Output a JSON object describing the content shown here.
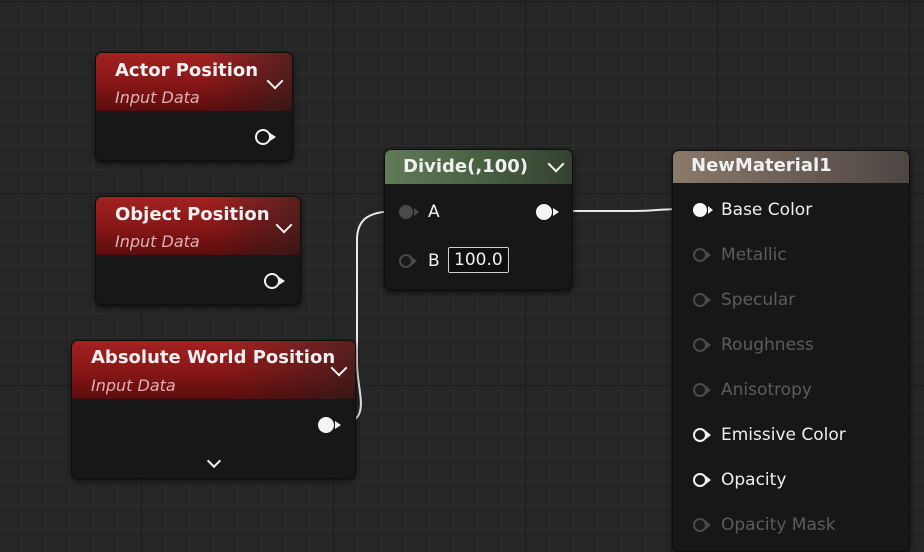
{
  "graph": {
    "nodes": {
      "actor_position": {
        "title": "Actor Position",
        "subtitle": "Input Data"
      },
      "object_position": {
        "title": "Object Position",
        "subtitle": "Input Data"
      },
      "absolute_world_position": {
        "title": "Absolute World Position",
        "subtitle": "Input Data"
      },
      "divide": {
        "title": "Divide(,100)",
        "inputs": [
          {
            "label": "A",
            "connected": true
          },
          {
            "label": "B",
            "connected": false,
            "value": "100.0"
          }
        ]
      },
      "material": {
        "title": "NewMaterial1",
        "inputs": [
          {
            "label": "Base Color",
            "state": "connected"
          },
          {
            "label": "Metallic",
            "state": "disabled"
          },
          {
            "label": "Specular",
            "state": "disabled"
          },
          {
            "label": "Roughness",
            "state": "disabled"
          },
          {
            "label": "Anisotropy",
            "state": "disabled"
          },
          {
            "label": "Emissive Color",
            "state": "enabled"
          },
          {
            "label": "Opacity",
            "state": "enabled"
          },
          {
            "label": "Opacity Mask",
            "state": "disabled"
          }
        ]
      }
    },
    "connections": [
      {
        "from": "absolute_world_position.output",
        "to": "divide.A"
      },
      {
        "from": "divide.output",
        "to": "material.Base Color"
      }
    ],
    "colors": {
      "input_data_header": "#8c1a1a",
      "math_header": "#4f6a48",
      "material_header": "#75685d",
      "wire": "#e8e8e8",
      "background": "#262626"
    }
  }
}
